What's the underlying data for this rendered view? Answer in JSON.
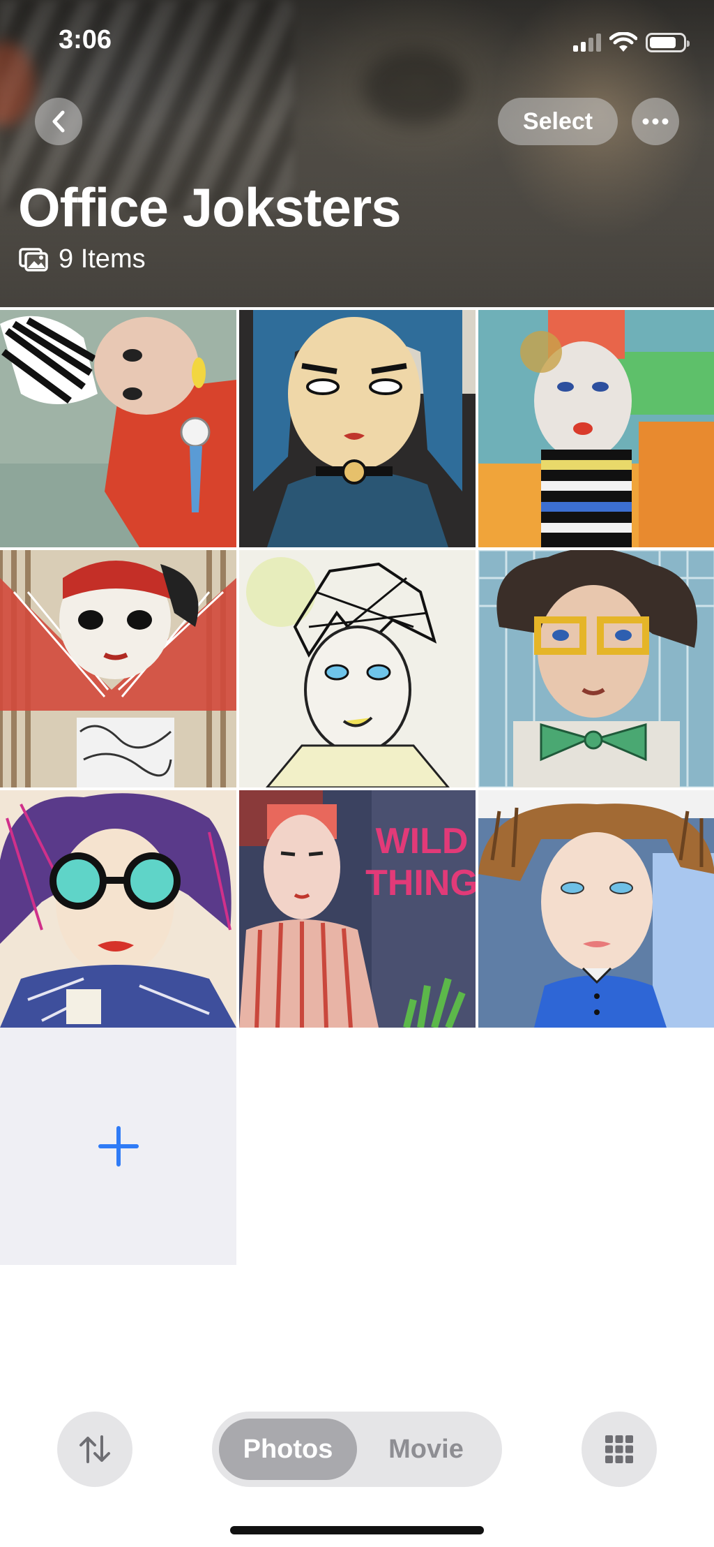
{
  "status_bar": {
    "time": "3:06"
  },
  "header": {
    "back_icon": "chevron-left-icon",
    "select_label": "Select",
    "more_icon": "ellipsis-icon",
    "title": "Office Joksters",
    "item_count": "9 Items",
    "count_icon": "photo-stack-icon"
  },
  "photos": [
    {
      "subject": "collage portrait, zebra pattern hair, red jacket"
    },
    {
      "subject": "blue-haired woman, black choker"
    },
    {
      "subject": "figure with red hat, striped top"
    },
    {
      "subject": "woman with red headband, red bow"
    },
    {
      "subject": "sketchy hair portrait, blue eyes"
    },
    {
      "subject": "curly hair, yellow glasses, green bow tie"
    },
    {
      "subject": "woman with teal glasses, red lips"
    },
    {
      "subject": "pink striped figure"
    },
    {
      "subject": "brown haired boy in blue shirt"
    }
  ],
  "wall_text": [
    "WILD",
    "THING"
  ],
  "add_icon": "plus-icon",
  "bottom_bar": {
    "sort_icon": "sort-arrows-icon",
    "tabs": [
      "Photos",
      "Movie"
    ],
    "active_tab": "Photos",
    "grid_icon": "grid-icon"
  },
  "colors": {
    "accent": "#2f7bf6"
  }
}
